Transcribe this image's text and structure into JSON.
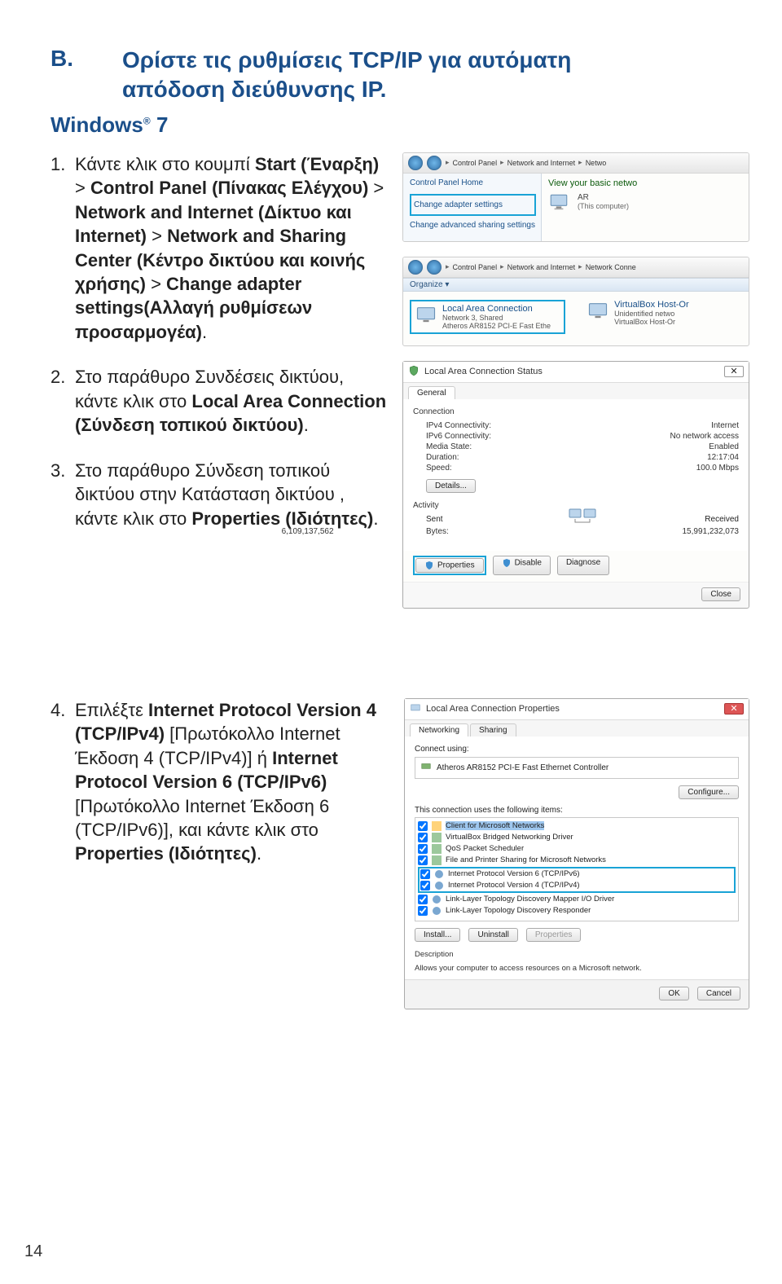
{
  "section": {
    "letter": "B.",
    "title_line1": "Ορίστε τις ρυθμίσεις TCP/IP για αυτόματη",
    "title_line2": "απόδοση διεύθυνσης IP."
  },
  "os": {
    "name": "Windows",
    "ver": "7"
  },
  "steps": {
    "s1": {
      "num": "1.",
      "pre": "Κάντε κλικ στο κουμπί ",
      "b1": "Start (Έναρξη)",
      "m1": " > ",
      "b2": "Control Panel (Πίνακας Ελέγχου)",
      "m2": " > ",
      "b3": "Network and Internet (Δίκτυο και Internet)",
      "m3": " > ",
      "b4": "Network and Sharing Center (Κέντρο δικτύου και κοινής χρήσης)",
      "m4": " > ",
      "b5": "Change adapter settings(Αλλαγή ρυθμίσεων προσαρμογέα)",
      "post": "."
    },
    "s2": {
      "num": "2.",
      "pre": "Στο παράθυρο Συνδέσεις δικτύου, κάντε κλικ στο ",
      "b1": "Local Area Connection (Σύνδεση τοπικού δικτύου)",
      "post": "."
    },
    "s3": {
      "num": "3.",
      "pre": "Στο παράθυρο Σύνδεση τοπικού δικτύου στην Κατάσταση δικτύου , κάντε κλικ στο ",
      "b1": "Properties (Ιδιότητες)",
      "post": "."
    },
    "s4": {
      "num": "4.",
      "pre": "Επιλέξτε ",
      "b1": "Internet Protocol Version 4 (TCP/IPv4)",
      "m1": " [Πρωτόκολλο Internet Έκδοση 4 (TCP/IPv4)] ή ",
      "b2": "Internet Protocol Version 6 (TCP/IPv6)",
      "m2": " [Πρωτόκολλο Internet Έκδοση 6 (TCP/IPv6)], και κάντε κλικ στο ",
      "b3": "Properties (Ιδιότητες)",
      "post": "."
    }
  },
  "shot1": {
    "crumbs": [
      "Control Panel",
      "Network and Internet",
      "Netwo"
    ],
    "home": "Control Panel Home",
    "link1": "Change adapter settings",
    "link2": "Change advanced sharing settings",
    "mainHeader": "View your basic netwo",
    "arName": "AR",
    "arSub": "(This computer)"
  },
  "shot2": {
    "crumbs": [
      "Control Panel",
      "Network and Internet",
      "Network Conne"
    ],
    "organize": "Organize ▾",
    "conn1": {
      "name": "Local Area Connection",
      "l2": "Network 3, Shared",
      "l3": "Atheros AR8152 PCI-E Fast Ethe"
    },
    "conn2": {
      "name": "VirtualBox Host-Or",
      "l2": "Unidentified netwo",
      "l3": "VirtualBox Host-Or"
    }
  },
  "shot3": {
    "title": "Local Area Connection Status",
    "tab": "General",
    "connectionHdr": "Connection",
    "kv": [
      {
        "k": "IPv4 Connectivity:",
        "v": "Internet"
      },
      {
        "k": "IPv6 Connectivity:",
        "v": "No network access"
      },
      {
        "k": "Media State:",
        "v": "Enabled"
      },
      {
        "k": "Duration:",
        "v": "12:17:04"
      },
      {
        "k": "Speed:",
        "v": "100.0 Mbps"
      }
    ],
    "details": "Details...",
    "activityHdr": "Activity",
    "sent": "Sent",
    "dash": "—",
    "received": "Received",
    "bytesL": "Bytes:",
    "bytesSent": "6,109,137,562",
    "bytesRecv": "15,991,232,073",
    "btnProps": "Properties",
    "btnDisable": "Disable",
    "btnDiag": "Diagnose",
    "close": "Close"
  },
  "shot4": {
    "title": "Local Area Connection Properties",
    "tab1": "Networking",
    "tab2": "Sharing",
    "connectUsing": "Connect using:",
    "adapter": "Atheros AR8152 PCI-E Fast Ethernet Controller",
    "configure": "Configure...",
    "usesLabel": "This connection uses the following items:",
    "items": [
      "Client for Microsoft Networks",
      "VirtualBox Bridged Networking Driver",
      "QoS Packet Scheduler",
      "File and Printer Sharing for Microsoft Networks",
      "Internet Protocol Version 6 (TCP/IPv6)",
      "Internet Protocol Version 4 (TCP/IPv4)",
      "Link-Layer Topology Discovery Mapper I/O Driver",
      "Link-Layer Topology Discovery Responder"
    ],
    "install": "Install...",
    "uninstall": "Uninstall",
    "properties": "Properties",
    "descHdr": "Description",
    "desc": "Allows your computer to access resources on a Microsoft network.",
    "ok": "OK",
    "cancel": "Cancel"
  },
  "page": "14"
}
